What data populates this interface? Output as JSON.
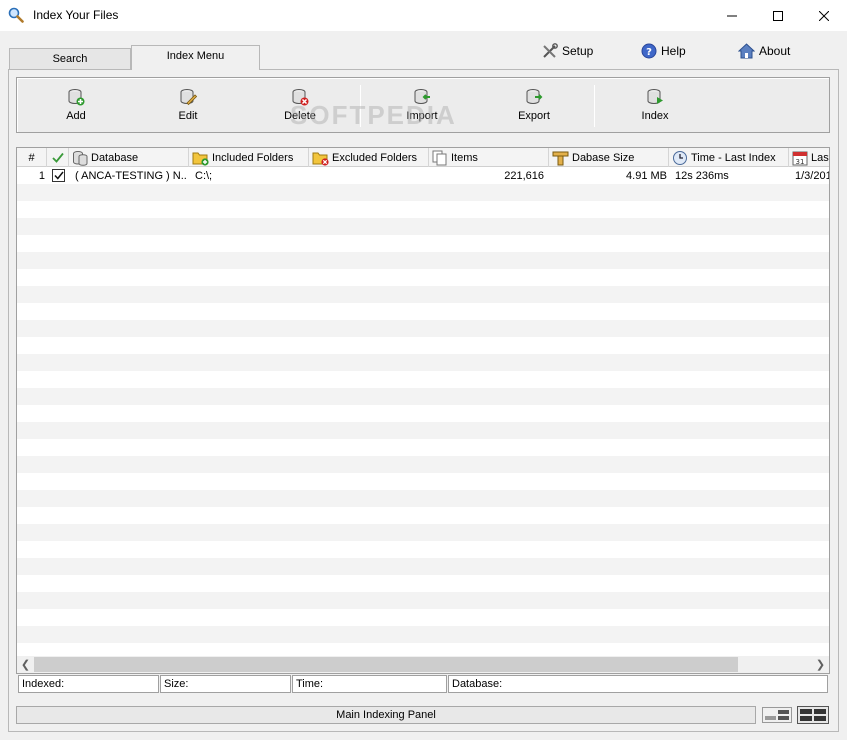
{
  "window": {
    "title": "Index Your Files"
  },
  "tabs": [
    {
      "label": "Search",
      "active": false
    },
    {
      "label": "Index Menu",
      "active": true
    }
  ],
  "toplinks": {
    "setup": "Setup",
    "help": "Help",
    "about": "About"
  },
  "toolbar": {
    "add": "Add",
    "edit": "Edit",
    "delete": "Delete",
    "import": "Import",
    "export": "Export",
    "index": "Index"
  },
  "watermark": "SOFTPEDIA",
  "grid": {
    "columns": {
      "num": "#",
      "database": "Database",
      "included": "Included Folders",
      "excluded": "Excluded Folders",
      "items": "Items",
      "size": "Dabase Size",
      "time": "Time - Last Index",
      "last": "Last"
    },
    "rows": [
      {
        "num": "1",
        "checked": true,
        "database": "( ANCA-TESTING ) N...",
        "included": "C:\\;",
        "excluded": "",
        "items": "221,616",
        "size": "4.91 MB",
        "time": "12s 236ms",
        "last": "1/3/201"
      }
    ]
  },
  "fields": {
    "indexed": "Indexed:",
    "size": "Size:",
    "time": "Time:",
    "database": "Database:"
  },
  "status": {
    "text": "Main Indexing Panel"
  },
  "colors": {
    "accent_green": "#2e9a2e",
    "accent_red": "#d02020",
    "stripe": "#f3f3f3",
    "folder_yellow": "#f2c53d"
  }
}
